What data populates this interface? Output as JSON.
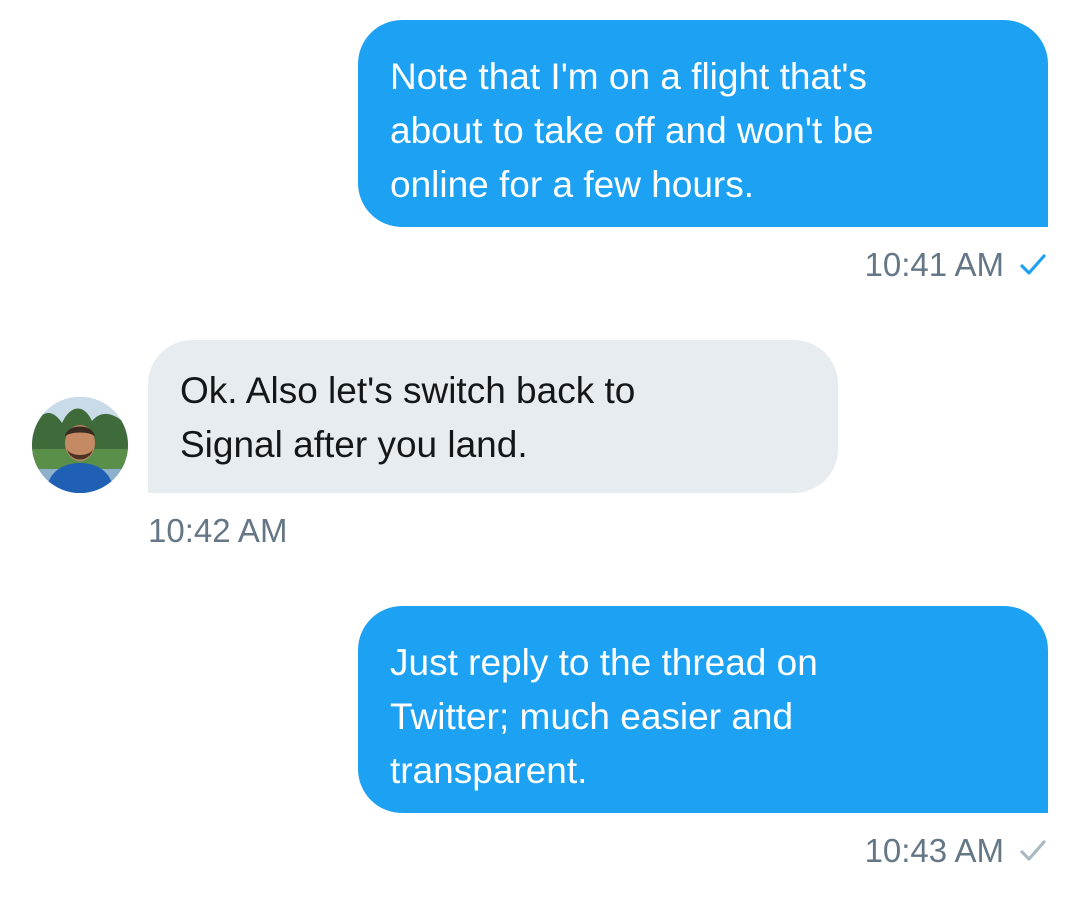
{
  "colors": {
    "sent_bubble": "#1da1f2",
    "received_bubble": "#e6ecf0",
    "timestamp_text": "#657786",
    "read_check": "#1da1f2",
    "sent_check": "#aab8c2"
  },
  "messages": [
    {
      "direction": "sent",
      "text": "Note that I'm on a flight that's\nabout to take off and won't be\nonline for a few hours.",
      "time": "10:41 AM",
      "status_icon": "checkmark-read-icon"
    },
    {
      "direction": "received",
      "text": "Ok. Also let's switch back to\nSignal after you land.",
      "time": "10:42 AM",
      "avatar": "contact-avatar"
    },
    {
      "direction": "sent",
      "text": "Just reply to the thread on\nTwitter; much easier and\ntransparent.",
      "time": "10:43 AM",
      "status_icon": "checkmark-sent-icon"
    }
  ]
}
